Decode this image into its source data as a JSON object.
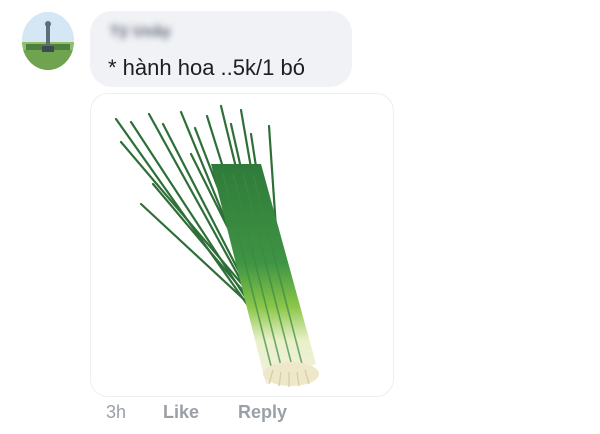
{
  "comment": {
    "author": "Tý Uxây",
    "text": "* hành hoa ..5k/1 bó",
    "avatar_icon": "profile-photo-statue",
    "attachment_icon": "green-onion-bunch-photo",
    "timestamp": "3h",
    "like_label": "Like",
    "reply_label": "Reply"
  }
}
